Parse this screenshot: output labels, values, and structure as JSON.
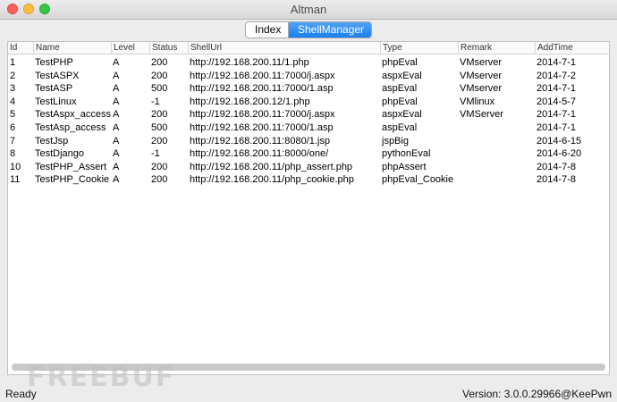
{
  "window": {
    "title": "Altman"
  },
  "tabs": [
    {
      "label": "Index",
      "active": false
    },
    {
      "label": "ShellManager",
      "active": true
    }
  ],
  "table": {
    "columns": [
      "Id",
      "Name",
      "Level",
      "Status",
      "ShellUrl",
      "Type",
      "Remark",
      "AddTime"
    ],
    "rows": [
      [
        "1",
        "TestPHP",
        "A",
        "200",
        "http://192.168.200.11/1.php",
        "phpEval",
        "VMserver",
        "2014-7-1"
      ],
      [
        "2",
        "TestASPX",
        "A",
        "200",
        "http://192.168.200.11:7000/j.aspx",
        "aspxEval",
        "VMserver",
        "2014-7-2"
      ],
      [
        "3",
        "TestASP",
        "A",
        "500",
        "http://192.168.200.11:7000/1.asp",
        "aspEval",
        "VMserver",
        "2014-7-1"
      ],
      [
        "4",
        "TestLinux",
        "A",
        "-1",
        "http://192.168.200.12/1.php",
        "phpEval",
        "VMlinux",
        "2014-5-7"
      ],
      [
        "5",
        "TestAspx_access",
        "A",
        "200",
        "http://192.168.200.11:7000/j.aspx",
        "aspxEval",
        "VMServer",
        "2014-7-1"
      ],
      [
        "6",
        "TestAsp_access",
        "A",
        "500",
        "http://192.168.200.11:7000/1.asp",
        "aspEval",
        "",
        "2014-7-1"
      ],
      [
        "7",
        "TestJsp",
        "A",
        "200",
        "http://192.168.200.11:8080/1.jsp",
        "jspBig",
        "",
        "2014-6-15"
      ],
      [
        "8",
        "TestDjango",
        "A",
        "-1",
        "http://192.168.200.11:8000/one/",
        "pythonEval",
        "",
        "2014-6-20"
      ],
      [
        "10",
        "TestPHP_Assert",
        "A",
        "200",
        "http://192.168.200.11/php_assert.php",
        "phpAssert",
        "",
        "2014-7-8"
      ],
      [
        "11",
        "TestPHP_Cookie",
        "A",
        "200",
        "http://192.168.200.11/php_cookie.php",
        "phpEval_Cookie",
        "",
        "2014-7-8"
      ]
    ]
  },
  "watermark": {
    "text": "FREEBUF"
  },
  "status": {
    "left": "Ready",
    "right": "Version: 3.0.0.29966@KeePwn"
  }
}
